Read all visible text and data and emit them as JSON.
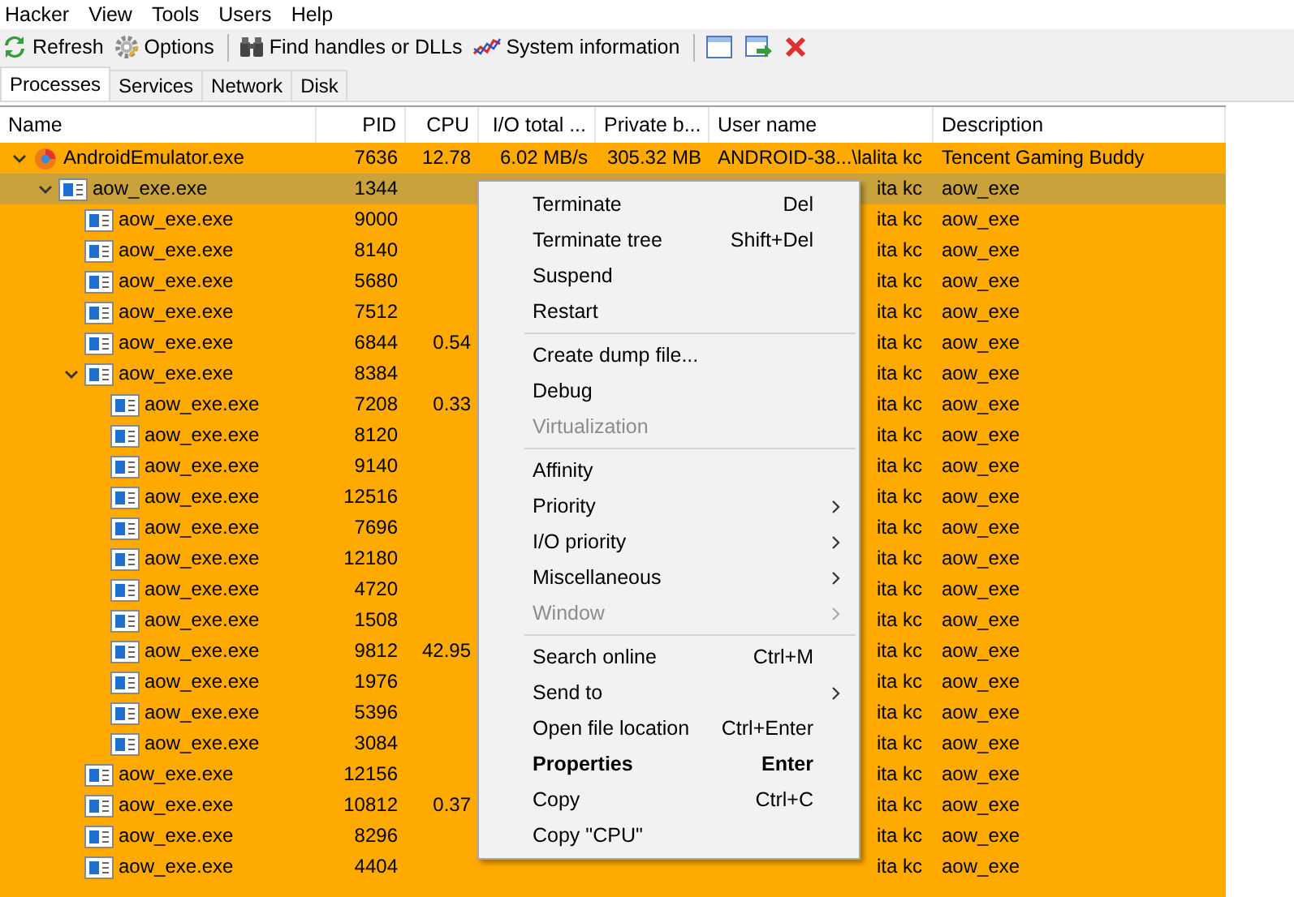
{
  "menu_bar": [
    "Hacker",
    "View",
    "Tools",
    "Users",
    "Help"
  ],
  "toolbar": [
    {
      "kind": "button",
      "label": "Refresh"
    },
    {
      "kind": "button",
      "label": "Options"
    },
    {
      "kind": "separator"
    },
    {
      "kind": "button",
      "label": "Find handles or DLLs"
    },
    {
      "kind": "button",
      "label": "System information"
    },
    {
      "kind": "separator"
    },
    {
      "kind": "icon"
    },
    {
      "kind": "icon"
    },
    {
      "kind": "icon"
    }
  ],
  "tabs": [
    {
      "label": "Processes",
      "selected": true
    },
    {
      "label": "Services",
      "selected": false
    },
    {
      "label": "Network",
      "selected": false
    },
    {
      "label": "Disk",
      "selected": false
    }
  ],
  "table": {
    "columns": [
      "Name",
      "PID",
      "CPU",
      "I/O total ...",
      "Private b...",
      "User name",
      "Description"
    ],
    "rows": [
      {
        "name": "AndroidEmulator.exe",
        "kind": "emulator",
        "pid": "7636",
        "cpu": "12.78",
        "io": "6.02 MB/s",
        "private": "305.32 MB",
        "user": "ANDROID-38...\\lalita kc",
        "description": "Tencent Gaming Buddy",
        "selected": false,
        "expanded": true,
        "children": [
          {
            "name": "aow_exe.exe",
            "kind": "window",
            "pid": "1344",
            "user": "ita kc",
            "description": "aow_exe",
            "selected": true,
            "expanded": true,
            "children": [
              {
                "name": "aow_exe.exe",
                "kind": "window",
                "pid": "9000",
                "user": "ita kc",
                "description": "aow_exe",
                "selected": false
              },
              {
                "name": "aow_exe.exe",
                "kind": "window",
                "pid": "8140",
                "user": "ita kc",
                "description": "aow_exe",
                "selected": false
              },
              {
                "name": "aow_exe.exe",
                "kind": "window",
                "pid": "5680",
                "user": "ita kc",
                "description": "aow_exe",
                "selected": false
              },
              {
                "name": "aow_exe.exe",
                "kind": "window",
                "pid": "7512",
                "user": "ita kc",
                "description": "aow_exe",
                "selected": false
              },
              {
                "name": "aow_exe.exe",
                "kind": "window",
                "pid": "6844",
                "cpu": "0.54",
                "user": "ita kc",
                "description": "aow_exe",
                "selected": false
              },
              {
                "name": "aow_exe.exe",
                "kind": "window",
                "pid": "8384",
                "user": "ita kc",
                "description": "aow_exe",
                "selected": false,
                "expanded": true,
                "children": [
                  {
                    "name": "aow_exe.exe",
                    "kind": "window",
                    "pid": "7208",
                    "cpu": "0.33",
                    "user": "ita kc",
                    "description": "aow_exe",
                    "selected": false
                  },
                  {
                    "name": "aow_exe.exe",
                    "kind": "window",
                    "pid": "8120",
                    "user": "ita kc",
                    "description": "aow_exe",
                    "selected": false
                  },
                  {
                    "name": "aow_exe.exe",
                    "kind": "window",
                    "pid": "9140",
                    "user": "ita kc",
                    "description": "aow_exe",
                    "selected": false
                  },
                  {
                    "name": "aow_exe.exe",
                    "kind": "window",
                    "pid": "12516",
                    "user": "ita kc",
                    "description": "aow_exe",
                    "selected": false
                  },
                  {
                    "name": "aow_exe.exe",
                    "kind": "window",
                    "pid": "7696",
                    "user": "ita kc",
                    "description": "aow_exe",
                    "selected": false
                  },
                  {
                    "name": "aow_exe.exe",
                    "kind": "window",
                    "pid": "12180",
                    "user": "ita kc",
                    "description": "aow_exe",
                    "selected": false
                  },
                  {
                    "name": "aow_exe.exe",
                    "kind": "window",
                    "pid": "4720",
                    "user": "ita kc",
                    "description": "aow_exe",
                    "selected": false
                  },
                  {
                    "name": "aow_exe.exe",
                    "kind": "window",
                    "pid": "1508",
                    "user": "ita kc",
                    "description": "aow_exe",
                    "selected": false
                  },
                  {
                    "name": "aow_exe.exe",
                    "kind": "window",
                    "pid": "9812",
                    "cpu": "42.95",
                    "user": "ita kc",
                    "description": "aow_exe",
                    "selected": false
                  },
                  {
                    "name": "aow_exe.exe",
                    "kind": "window",
                    "pid": "1976",
                    "user": "ita kc",
                    "description": "aow_exe",
                    "selected": false
                  },
                  {
                    "name": "aow_exe.exe",
                    "kind": "window",
                    "pid": "5396",
                    "user": "ita kc",
                    "description": "aow_exe",
                    "selected": false
                  },
                  {
                    "name": "aow_exe.exe",
                    "kind": "window",
                    "pid": "3084",
                    "user": "ita kc",
                    "description": "aow_exe",
                    "selected": false
                  }
                ]
              },
              {
                "name": "aow_exe.exe",
                "kind": "window",
                "pid": "12156",
                "user": "ita kc",
                "description": "aow_exe",
                "selected": false
              },
              {
                "name": "aow_exe.exe",
                "kind": "window",
                "pid": "10812",
                "cpu": "0.37",
                "user": "ita kc",
                "description": "aow_exe",
                "selected": false
              },
              {
                "name": "aow_exe.exe",
                "kind": "window",
                "pid": "8296",
                "user": "ita kc",
                "description": "aow_exe",
                "selected": false
              },
              {
                "name": "aow_exe.exe",
                "kind": "window",
                "pid": "4404",
                "user": "ita kc",
                "description": "aow_exe",
                "selected": false
              }
            ]
          }
        ]
      }
    ]
  },
  "context_menu": [
    {
      "kind": "item",
      "label": "Terminate",
      "shortcut": "Del"
    },
    {
      "kind": "item",
      "label": "Terminate tree",
      "shortcut": "Shift+Del"
    },
    {
      "kind": "item",
      "label": "Suspend"
    },
    {
      "kind": "item",
      "label": "Restart"
    },
    {
      "kind": "separator"
    },
    {
      "kind": "item",
      "label": "Create dump file..."
    },
    {
      "kind": "item",
      "label": "Debug"
    },
    {
      "kind": "item",
      "label": "Virtualization",
      "disabled": true
    },
    {
      "kind": "separator"
    },
    {
      "kind": "item",
      "label": "Affinity"
    },
    {
      "kind": "item",
      "label": "Priority",
      "submenu": true
    },
    {
      "kind": "item",
      "label": "I/O priority",
      "submenu": true
    },
    {
      "kind": "item",
      "label": "Miscellaneous",
      "submenu": true
    },
    {
      "kind": "item",
      "label": "Window",
      "submenu": true,
      "disabled": true
    },
    {
      "kind": "separator"
    },
    {
      "kind": "item",
      "label": "Search online",
      "shortcut": "Ctrl+M"
    },
    {
      "kind": "item",
      "label": "Send to",
      "submenu": true
    },
    {
      "kind": "item",
      "label": "Open file location",
      "shortcut": "Ctrl+Enter"
    },
    {
      "kind": "item",
      "label": "Properties",
      "shortcut": "Enter",
      "default": true
    },
    {
      "kind": "item",
      "label": "Copy",
      "shortcut": "Ctrl+C"
    },
    {
      "kind": "item",
      "label": "Copy \"CPU\""
    }
  ]
}
